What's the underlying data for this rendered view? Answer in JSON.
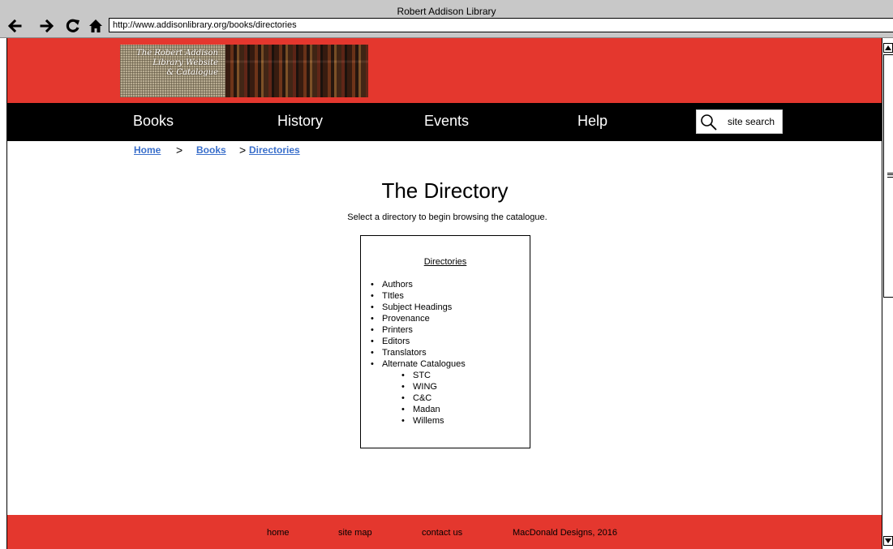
{
  "browser": {
    "window_title": "Robert Addison Library",
    "url": "http://www.addisonlibrary.org/books/directories",
    "buttons": [
      "back-arrow-icon",
      "forward-arrow-icon",
      "reload-icon",
      "home-icon"
    ]
  },
  "header": {
    "logo_text_line1": "The Robert Addison",
    "logo_text_line2": "Library Website",
    "logo_text_line3": "& Catalogue"
  },
  "nav": {
    "items": [
      {
        "label": "Books"
      },
      {
        "label": "History"
      },
      {
        "label": "Events"
      },
      {
        "label": "Help"
      }
    ],
    "search_label": "site search"
  },
  "breadcrumb": {
    "home": "Home",
    "books": "Books",
    "directories": "Directories",
    "separator": ">"
  },
  "main": {
    "title": "The Directory",
    "intro": "Select a directory to begin browsing the catalogue."
  },
  "directories": {
    "heading": "Directories",
    "items": [
      {
        "label": "Authors"
      },
      {
        "label": "TItles"
      },
      {
        "label": "Subject Headings"
      },
      {
        "label": "Provenance"
      },
      {
        "label": "Printers"
      },
      {
        "label": "Editors"
      },
      {
        "label": "Translators"
      },
      {
        "label": "Alternate Catalogues"
      }
    ],
    "alternate": [
      {
        "label": "STC"
      },
      {
        "label": "WING"
      },
      {
        "label": "C&C"
      },
      {
        "label": "Madan"
      },
      {
        "label": "Willems"
      }
    ]
  },
  "footer": {
    "home": "home",
    "site_map": "site map",
    "contact": "contact us",
    "credit": "MacDonald Designs, 2016"
  },
  "colors": {
    "accent_red": "#e4372e",
    "nav_black": "#000000",
    "link_blue": "#3a6fcb",
    "chrome_gray": "#c8c8c8"
  }
}
